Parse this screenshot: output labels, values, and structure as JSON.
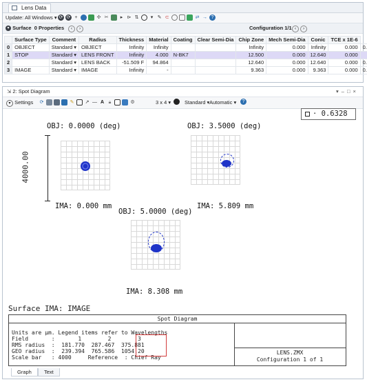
{
  "lens_window": {
    "tab_title": "Lens Data",
    "update_label": "Update: All Windows",
    "surface_label": "Surface",
    "properties_label": "0 Properties",
    "configuration_label": "Configuration 1/1",
    "columns": [
      "",
      "Surface Type",
      "Comment",
      "Radius",
      "Thickness",
      "Material",
      "Coating",
      "Clear Semi-Dia",
      "Chip Zone",
      "Mech Semi-Dia",
      "Conic",
      "TCE x 1E-6"
    ],
    "rows": [
      {
        "num": "0",
        "name": "OBJECT",
        "type": "Standard",
        "comment": "OBJECT",
        "radius": "Infinity",
        "thickness": "Infinity",
        "material": "",
        "coating": "",
        "clear": "Infinity",
        "chip": "0.000",
        "mech": "Infinity",
        "conic": "0.000",
        "tce": "0.000"
      },
      {
        "num": "1",
        "name": "STOP",
        "type": "Standard",
        "comment": "LENS FRONT",
        "radius": "Infinity",
        "thickness": "4.000",
        "material": "N-BK7",
        "coating": "",
        "clear": "12.500",
        "chip": "0.000",
        "mech": "12.640",
        "conic": "0.000",
        "tce": "-"
      },
      {
        "num": "2",
        "name": "",
        "type": "Standard",
        "comment": "LENS BACK",
        "radius": "-51.509 F",
        "thickness": "94.864",
        "material": "",
        "coating": "",
        "clear": "12.640",
        "chip": "0.000",
        "mech": "12.640",
        "conic": "0.000",
        "tce": "0.000"
      },
      {
        "num": "3",
        "name": "IMAGE",
        "type": "Standard",
        "comment": "IMAGE",
        "radius": "Infinity",
        "thickness": "-",
        "material": "",
        "coating": "",
        "clear": "9.363",
        "chip": "0.000",
        "mech": "9.363",
        "conic": "0.000",
        "tce": "0.000"
      }
    ]
  },
  "spot_window": {
    "title": "2: Spot Diagram",
    "settings_label": "Settings",
    "layout_label": "3 x 4",
    "standard_label": "Standard",
    "automatic_label": "Automatic",
    "wavelength_value": "0.6328",
    "scale_label": "4000.00",
    "fields": [
      {
        "obj": "OBJ: 0.0000 (deg)",
        "ima": "IMA: 0.000 mm"
      },
      {
        "obj": "OBJ: 3.5000 (deg)",
        "ima": "IMA: 5.809 mm"
      },
      {
        "obj": "OBJ: 5.0000 (deg)",
        "ima": "IMA: 8.308 mm"
      }
    ],
    "surface_label": "Surface IMA: IMAGE",
    "info_title": "Spot Diagram",
    "info_lines": [
      "Units are µm. Legend items refer to Wavelengths",
      "Field       :       1        2        3",
      "RMS radius  :  181.770  287.467  375.881",
      "GEO radius  :  239.394  765.586  1054.20",
      "Scale bar   : 4000     Reference  : Chief Ray"
    ],
    "file_name": "LENS.ZMX",
    "configuration": "Configuration 1 of 1",
    "tabs": [
      "Graph",
      "Text"
    ],
    "accent": "#1f34c8"
  }
}
